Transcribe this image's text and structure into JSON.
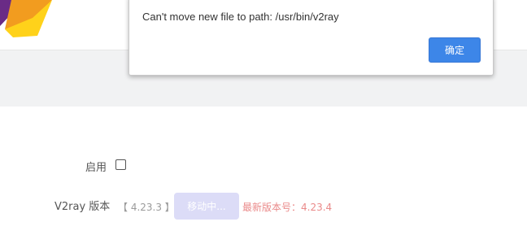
{
  "colors": {
    "accent_blue": "#3d86e8",
    "logo_orange": "#f29c1f",
    "logo_yellow": "#ffd21a",
    "logo_purple": "#6a2b86",
    "latest_version_red": "#ea8a8a",
    "disabled_button": "#dcdcf7"
  },
  "dialog": {
    "message": "Can't move new file to path: /usr/bin/v2ray",
    "ok_label": "确定"
  },
  "form": {
    "enable_label": "启用",
    "enable_checked": false,
    "version_label": "V2ray 版本",
    "current_version": "【 4.23.3 】",
    "moving_button_label": "移动中...",
    "latest_version": "最新版本号：4.23.4"
  }
}
